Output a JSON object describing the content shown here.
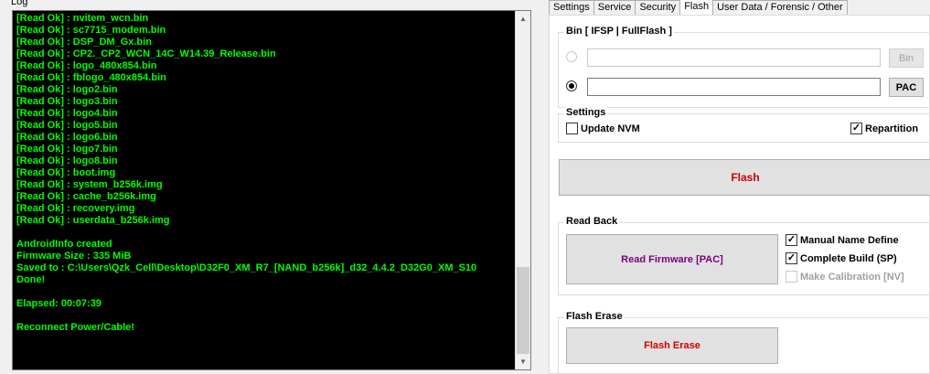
{
  "log": {
    "title": "Log",
    "lines": [
      "[Read Ok] : nvitem_wcn.bin",
      "[Read Ok] : sc7715_modem.bin",
      "[Read Ok] : DSP_DM_Gx.bin",
      "[Read Ok] : CP2._CP2_WCN_14C_W14.39_Release.bin",
      "[Read Ok] : logo_480x854.bin",
      "[Read Ok] : fblogo_480x854.bin",
      "[Read Ok] : logo2.bin",
      "[Read Ok] : logo3.bin",
      "[Read Ok] : logo4.bin",
      "[Read Ok] : logo5.bin",
      "[Read Ok] : logo6.bin",
      "[Read Ok] : logo7.bin",
      "[Read Ok] : logo8.bin",
      "[Read Ok] : boot.img",
      "[Read Ok] : system_b256k.img",
      "[Read Ok] : cache_b256k.img",
      "[Read Ok] : recovery.img",
      "[Read Ok] : userdata_b256k.img",
      "",
      "AndroidInfo created",
      "Firmware Size : 335 MiB",
      "Saved to : C:\\Users\\Qzk_Cell\\Desktop\\D32F0_XM_R7_[NAND_b256k]_d32_4.4.2_D32G0_XM_S10",
      "Done!",
      "",
      "Elapsed: 00:07:39",
      "",
      "Reconnect Power/Cable!"
    ],
    "text_color": "#00ff00",
    "bg_color": "#000000"
  },
  "tabs": [
    {
      "label": "Settings",
      "active": false
    },
    {
      "label": "Service",
      "active": false
    },
    {
      "label": "Security",
      "active": false
    },
    {
      "label": "Flash",
      "active": true
    },
    {
      "label": "User Data / Forensic / Other",
      "active": false
    }
  ],
  "bin_group": {
    "label": "Bin  [ IFSP | FullFlash ]",
    "bin_path_value": "",
    "pac_path_value": "",
    "bin_button": "Bin",
    "pac_button": "PAC"
  },
  "settings_group": {
    "label": "Settings",
    "update_nvm": {
      "label": "Update NVM",
      "checked": false
    },
    "repartition": {
      "label": "Repartition",
      "checked": true
    }
  },
  "flash_button": "Flash",
  "read_back": {
    "label": "Read Back",
    "read_firmware_button": "Read Firmware [PAC]",
    "manual_name": {
      "label": "Manual Name Define",
      "checked": true
    },
    "complete_build": {
      "label": "Complete Build (SP)",
      "checked": true
    },
    "make_calibration": {
      "label": "Make Calibration [NV]",
      "checked": false
    }
  },
  "flash_erase": {
    "label": "Flash Erase",
    "button": "Flash Erase"
  },
  "check_mark": "✓",
  "colors": {
    "flash_red": "#cc0000",
    "read_fw_purple": "#7a007a"
  }
}
